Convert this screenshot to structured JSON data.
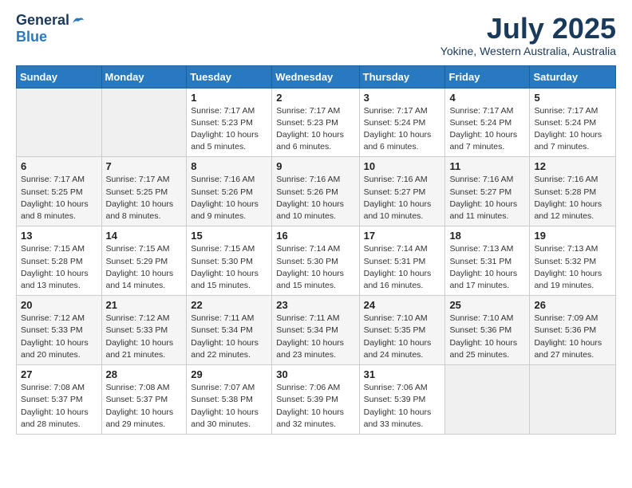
{
  "logo": {
    "general": "General",
    "blue": "Blue"
  },
  "title": "July 2025",
  "location": "Yokine, Western Australia, Australia",
  "days_of_week": [
    "Sunday",
    "Monday",
    "Tuesday",
    "Wednesday",
    "Thursday",
    "Friday",
    "Saturday"
  ],
  "weeks": [
    [
      {
        "day": "",
        "info": ""
      },
      {
        "day": "",
        "info": ""
      },
      {
        "day": "1",
        "info": "Sunrise: 7:17 AM\nSunset: 5:23 PM\nDaylight: 10 hours\nand 5 minutes."
      },
      {
        "day": "2",
        "info": "Sunrise: 7:17 AM\nSunset: 5:23 PM\nDaylight: 10 hours\nand 6 minutes."
      },
      {
        "day": "3",
        "info": "Sunrise: 7:17 AM\nSunset: 5:24 PM\nDaylight: 10 hours\nand 6 minutes."
      },
      {
        "day": "4",
        "info": "Sunrise: 7:17 AM\nSunset: 5:24 PM\nDaylight: 10 hours\nand 7 minutes."
      },
      {
        "day": "5",
        "info": "Sunrise: 7:17 AM\nSunset: 5:24 PM\nDaylight: 10 hours\nand 7 minutes."
      }
    ],
    [
      {
        "day": "6",
        "info": "Sunrise: 7:17 AM\nSunset: 5:25 PM\nDaylight: 10 hours\nand 8 minutes."
      },
      {
        "day": "7",
        "info": "Sunrise: 7:17 AM\nSunset: 5:25 PM\nDaylight: 10 hours\nand 8 minutes."
      },
      {
        "day": "8",
        "info": "Sunrise: 7:16 AM\nSunset: 5:26 PM\nDaylight: 10 hours\nand 9 minutes."
      },
      {
        "day": "9",
        "info": "Sunrise: 7:16 AM\nSunset: 5:26 PM\nDaylight: 10 hours\nand 10 minutes."
      },
      {
        "day": "10",
        "info": "Sunrise: 7:16 AM\nSunset: 5:27 PM\nDaylight: 10 hours\nand 10 minutes."
      },
      {
        "day": "11",
        "info": "Sunrise: 7:16 AM\nSunset: 5:27 PM\nDaylight: 10 hours\nand 11 minutes."
      },
      {
        "day": "12",
        "info": "Sunrise: 7:16 AM\nSunset: 5:28 PM\nDaylight: 10 hours\nand 12 minutes."
      }
    ],
    [
      {
        "day": "13",
        "info": "Sunrise: 7:15 AM\nSunset: 5:28 PM\nDaylight: 10 hours\nand 13 minutes."
      },
      {
        "day": "14",
        "info": "Sunrise: 7:15 AM\nSunset: 5:29 PM\nDaylight: 10 hours\nand 14 minutes."
      },
      {
        "day": "15",
        "info": "Sunrise: 7:15 AM\nSunset: 5:30 PM\nDaylight: 10 hours\nand 15 minutes."
      },
      {
        "day": "16",
        "info": "Sunrise: 7:14 AM\nSunset: 5:30 PM\nDaylight: 10 hours\nand 15 minutes."
      },
      {
        "day": "17",
        "info": "Sunrise: 7:14 AM\nSunset: 5:31 PM\nDaylight: 10 hours\nand 16 minutes."
      },
      {
        "day": "18",
        "info": "Sunrise: 7:13 AM\nSunset: 5:31 PM\nDaylight: 10 hours\nand 17 minutes."
      },
      {
        "day": "19",
        "info": "Sunrise: 7:13 AM\nSunset: 5:32 PM\nDaylight: 10 hours\nand 19 minutes."
      }
    ],
    [
      {
        "day": "20",
        "info": "Sunrise: 7:12 AM\nSunset: 5:33 PM\nDaylight: 10 hours\nand 20 minutes."
      },
      {
        "day": "21",
        "info": "Sunrise: 7:12 AM\nSunset: 5:33 PM\nDaylight: 10 hours\nand 21 minutes."
      },
      {
        "day": "22",
        "info": "Sunrise: 7:11 AM\nSunset: 5:34 PM\nDaylight: 10 hours\nand 22 minutes."
      },
      {
        "day": "23",
        "info": "Sunrise: 7:11 AM\nSunset: 5:34 PM\nDaylight: 10 hours\nand 23 minutes."
      },
      {
        "day": "24",
        "info": "Sunrise: 7:10 AM\nSunset: 5:35 PM\nDaylight: 10 hours\nand 24 minutes."
      },
      {
        "day": "25",
        "info": "Sunrise: 7:10 AM\nSunset: 5:36 PM\nDaylight: 10 hours\nand 25 minutes."
      },
      {
        "day": "26",
        "info": "Sunrise: 7:09 AM\nSunset: 5:36 PM\nDaylight: 10 hours\nand 27 minutes."
      }
    ],
    [
      {
        "day": "27",
        "info": "Sunrise: 7:08 AM\nSunset: 5:37 PM\nDaylight: 10 hours\nand 28 minutes."
      },
      {
        "day": "28",
        "info": "Sunrise: 7:08 AM\nSunset: 5:37 PM\nDaylight: 10 hours\nand 29 minutes."
      },
      {
        "day": "29",
        "info": "Sunrise: 7:07 AM\nSunset: 5:38 PM\nDaylight: 10 hours\nand 30 minutes."
      },
      {
        "day": "30",
        "info": "Sunrise: 7:06 AM\nSunset: 5:39 PM\nDaylight: 10 hours\nand 32 minutes."
      },
      {
        "day": "31",
        "info": "Sunrise: 7:06 AM\nSunset: 5:39 PM\nDaylight: 10 hours\nand 33 minutes."
      },
      {
        "day": "",
        "info": ""
      },
      {
        "day": "",
        "info": ""
      }
    ]
  ]
}
